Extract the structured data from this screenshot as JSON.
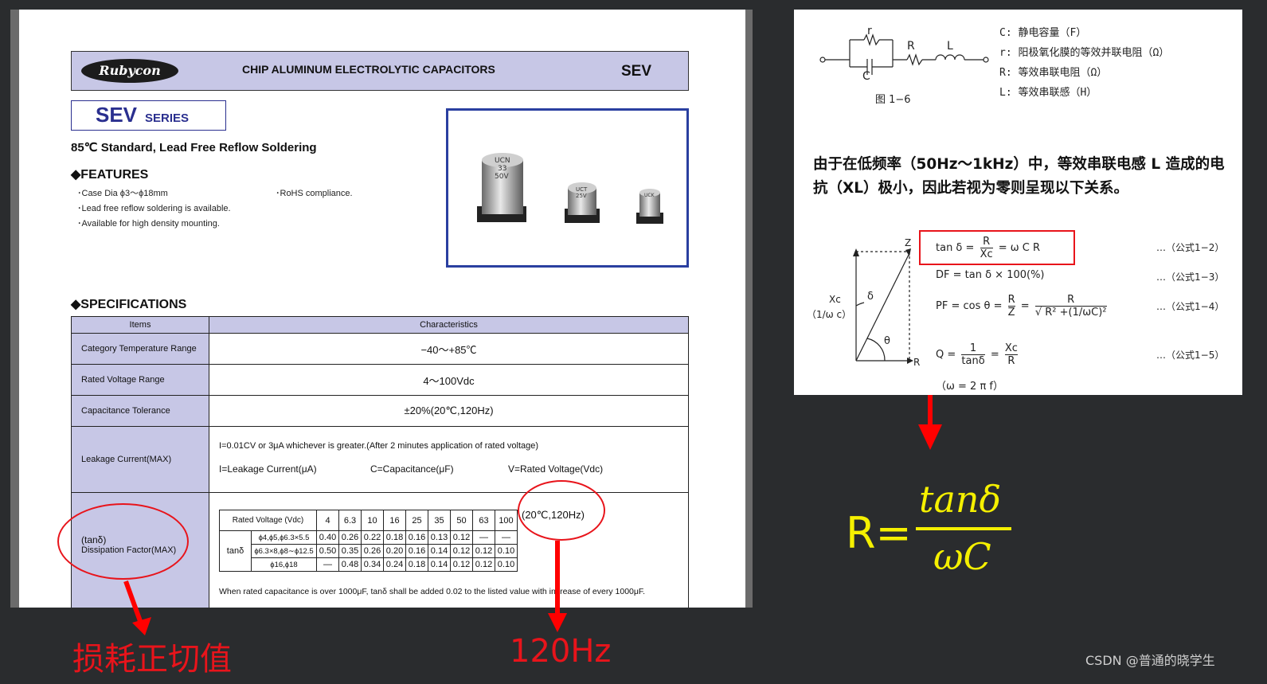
{
  "datasheet": {
    "brand": "Rubycon",
    "title": "CHIP ALUMINUM ELECTROLYTIC CAPACITORS",
    "code": "SEV",
    "series_name": "SEV",
    "series_suffix": "SERIES",
    "subtitle": "85℃ Standard, Lead Free Reflow Soldering",
    "features_title": "◆FEATURES",
    "features": [
      "･Case Dia ϕ3～ϕ18mm",
      "･Lead free reflow soldering is available.",
      "･Available for high density mounting.",
      "･RoHS compliance."
    ],
    "capacitor_marks": [
      [
        "UCN",
        "33",
        "50V"
      ],
      [
        "UCT",
        "25V"
      ],
      [
        "UCK"
      ]
    ],
    "specs_title": "◆SPECIFICATIONS",
    "col_items": "Items",
    "col_char": "Characteristics",
    "rows": [
      {
        "item": "Category Temperature Range",
        "value": "−40～+85℃"
      },
      {
        "item": "Rated Voltage Range",
        "value": "4～100Vdc"
      },
      {
        "item": "Capacitance Tolerance",
        "value": "±20%(20℃,120Hz)"
      }
    ],
    "leakage": {
      "item": "Leakage Current(MAX)",
      "formula": "I=0.01CV or 3μA whichever is greater.(After 2 minutes application of rated voltage)",
      "i_def": "I=Leakage Current(μA)",
      "c_def": "C=Capacitance(μF)",
      "v_def": "V=Rated Voltage(Vdc)"
    },
    "df": {
      "item_sym": "(tanδ)",
      "item": "Dissipation Factor(MAX)",
      "cond": "(20℃,120Hz)",
      "rv_label": "Rated Voltage (Vdc)",
      "tan_label": "tanδ",
      "voltages": [
        "4",
        "6.3",
        "10",
        "16",
        "25",
        "35",
        "50",
        "63",
        "100"
      ],
      "rows": [
        {
          "size": "ϕ4,ϕ5,ϕ6.3×5.5",
          "vals": [
            "0.40",
            "0.26",
            "0.22",
            "0.18",
            "0.16",
            "0.13",
            "0.12",
            "—",
            "—"
          ]
        },
        {
          "size": "ϕ6.3×8,ϕ8∼ϕ12.5",
          "vals": [
            "0.50",
            "0.35",
            "0.26",
            "0.20",
            "0.16",
            "0.14",
            "0.12",
            "0.12",
            "0.10"
          ]
        },
        {
          "size": "ϕ16,ϕ18",
          "vals": [
            "—",
            "0.48",
            "0.34",
            "0.24",
            "0.18",
            "0.14",
            "0.12",
            "0.12",
            "0.10"
          ]
        }
      ],
      "note": "When rated capacitance is over 1000μF, tanδ shall be added 0.02 to the listed value with increase of every 1000μF."
    }
  },
  "annotations": {
    "loss_tangent": "损耗正切值",
    "freq": "120Hz"
  },
  "textbook": {
    "circuit": {
      "r": "r",
      "c": "C",
      "R": "R",
      "L": "L",
      "fig": "图 1−6"
    },
    "legend": [
      "C: 静电容量（F）",
      "r: 阳极氧化膜的等效并联电阻（Ω）",
      "R: 等效串联电阻（Ω）",
      "L: 等效串联感（H）"
    ],
    "paragraph": "由于在低频率（50Hz～1kHz）中，等效串联电感 L 造成的电抗（XL）极小，因此若视为零则呈现以下关系。",
    "triangle": {
      "z": "Z",
      "xc": "Xc",
      "xc2": "（1/ω c）",
      "delta": "δ",
      "theta": "θ",
      "r": "R"
    },
    "eq1": {
      "lhs": "tan δ =",
      "num": "R",
      "den": "Xc",
      "rhs": "= ω C R",
      "id": "…（公式1−2）"
    },
    "eq2": {
      "text": "DF  = tan δ  × 100(%)",
      "id": "…（公式1−3）"
    },
    "eq3": {
      "lhs": "PF  = cos θ =",
      "num1": "R",
      "den1": "Z",
      "eq": "=",
      "num2": "R",
      "den2": "√ R² +(1/ωC)²",
      "id": "…（公式1−4）"
    },
    "eq4": {
      "lhs": "Q  =",
      "num1": "1",
      "den1": "tanδ",
      "eq": "=",
      "num2": "Xc",
      "den2": "R",
      "id": "…（公式1−5）"
    },
    "eq5": "（ω  = 2 π f）"
  },
  "result": {
    "lhs": "R=",
    "num": "tanδ",
    "den": "ωC"
  },
  "watermark": "CSDN @普通的晓学生",
  "colors": {
    "annotation_red": "#e8141b",
    "result_yellow": "#f5f000",
    "header_lavender": "#c7c7e6"
  }
}
